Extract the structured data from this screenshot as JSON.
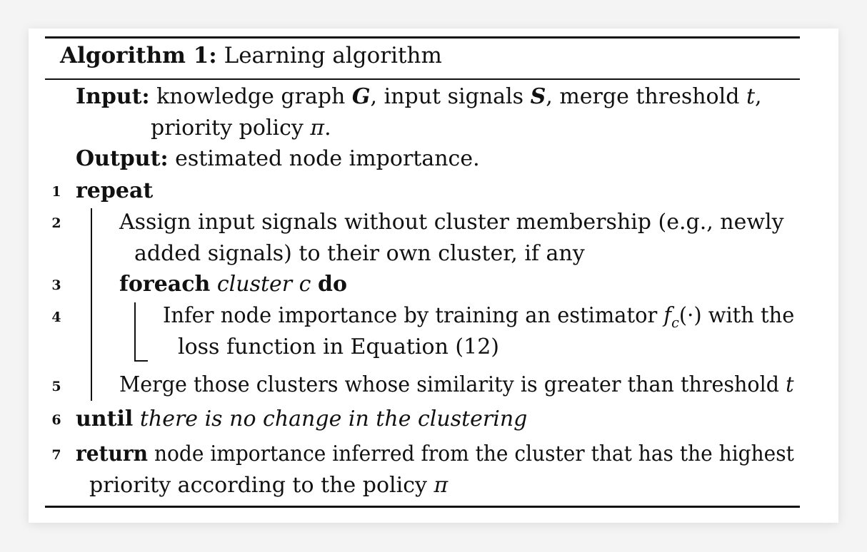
{
  "algorithm": {
    "title_bold": "Algorithm 1:",
    "title_text": "Learning algorithm",
    "input": {
      "keyword": "Input:",
      "text_a": "knowledge graph ",
      "var_g": "G",
      "text_b": ", input signals ",
      "var_s": "S",
      "text_c": ", merge threshold ",
      "var_t": "t",
      "text_d": ",",
      "cont_text": "priority policy ",
      "var_pi": "π",
      "cont_end": "."
    },
    "output": {
      "keyword": "Output:",
      "text": "estimated node importance."
    },
    "lines": [
      {
        "num": "1",
        "keyword": "repeat"
      },
      {
        "num": "2",
        "text": "Assign input signals without cluster membership (e.g., newly",
        "cont": "added signals) to their own cluster, if any"
      },
      {
        "num": "3",
        "keyword": "foreach",
        "italic": "cluster c",
        "keyword2": "do"
      },
      {
        "num": "4",
        "text_a": "Infer node importance by training an estimator ",
        "fn": "f",
        "sub": "c",
        "args": "(·)",
        "text_b": " with the",
        "cont": "loss function in Equation (12)"
      },
      {
        "num": "5",
        "text": "Merge those clusters whose similarity is greater than threshold ",
        "var": "t"
      },
      {
        "num": "6",
        "keyword": "until",
        "italic": "there is no change in the clustering"
      },
      {
        "num": "7",
        "keyword": "return",
        "text": "node importance inferred from the cluster that has the highest",
        "cont": "priority according to the policy ",
        "var": "π"
      }
    ]
  }
}
